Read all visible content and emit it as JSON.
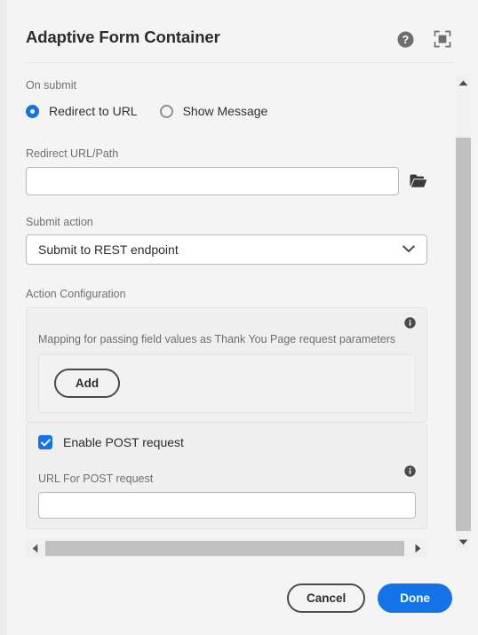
{
  "header": {
    "title": "Adaptive Form Container",
    "help_icon": "help-circle-icon",
    "fullscreen_icon": "fullscreen-icon"
  },
  "on_submit": {
    "label": "On submit",
    "options": [
      {
        "label": "Redirect to URL",
        "selected": true
      },
      {
        "label": "Show Message",
        "selected": false
      }
    ]
  },
  "redirect_url": {
    "label": "Redirect URL/Path",
    "value": "",
    "placeholder": "",
    "browse_icon": "folder-icon"
  },
  "submit_action": {
    "label": "Submit action",
    "value": "Submit to REST endpoint",
    "chevron_icon": "chevron-down-icon"
  },
  "action_configuration": {
    "label": "Action Configuration",
    "mapping": {
      "description": "Mapping for passing field values as Thank You Page request parameters",
      "info_icon": "info-icon",
      "add_label": "Add"
    },
    "post": {
      "checkbox_label": "Enable POST request",
      "checked": true,
      "url_label": "URL For POST request",
      "url_value": "",
      "url_placeholder": "",
      "info_icon": "info-icon"
    }
  },
  "scrollbars": {
    "vertical": {
      "up_icon": "triangle-up-icon",
      "down_icon": "triangle-down-icon"
    },
    "horizontal": {
      "left_icon": "triangle-left-icon",
      "right_icon": "triangle-right-icon"
    }
  },
  "footer": {
    "cancel_label": "Cancel",
    "done_label": "Done"
  },
  "colors": {
    "accent": "#1473e6",
    "background": "#f4f4f4",
    "text": "#2c2c2c",
    "muted_text": "#707070",
    "scrollbar_thumb": "#c0c0c0"
  }
}
